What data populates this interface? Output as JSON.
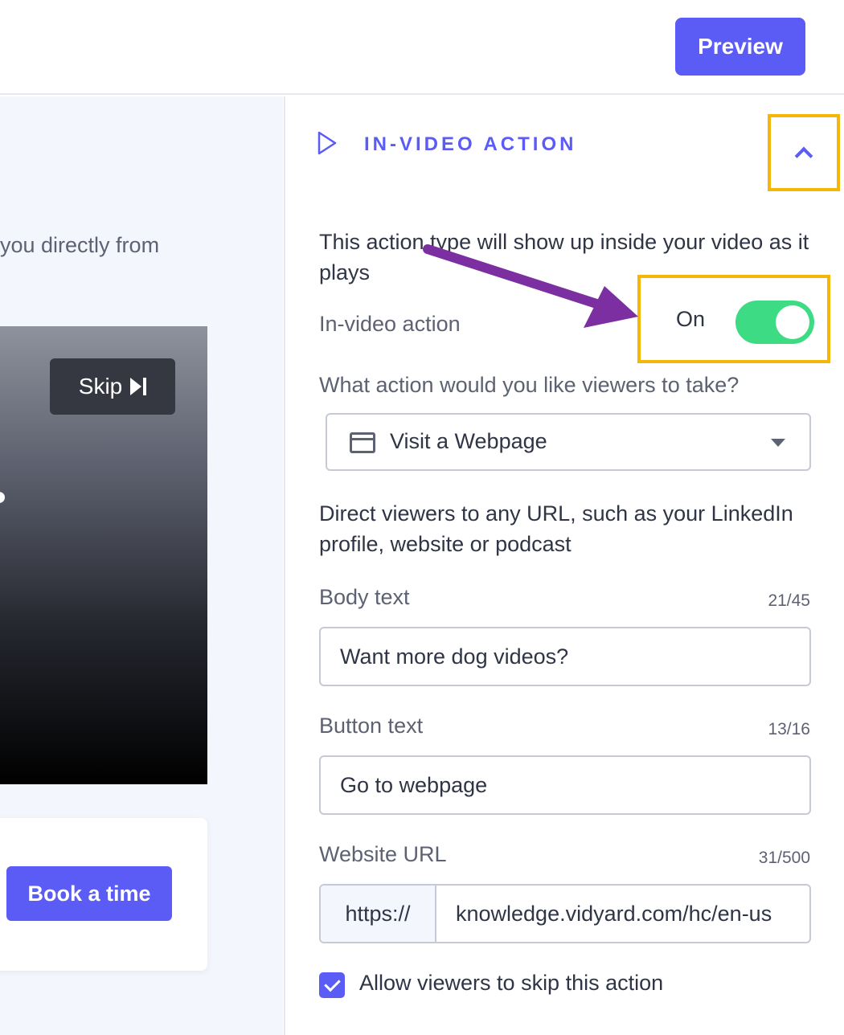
{
  "header": {
    "preview_label": "Preview"
  },
  "left_panel": {
    "description_fragment": "you directly from",
    "skip_label": "Skip",
    "book_label": "Book a time"
  },
  "section": {
    "title": "IN-VIDEO ACTION",
    "intro": "This action type will show up inside your video as it plays",
    "toggle_label": "In-video action",
    "toggle_state": "On",
    "question": "What action would you like viewers to take?",
    "action_value": "Visit a Webpage",
    "help_text": "Direct viewers to any URL, such as your LinkedIn profile, website or podcast"
  },
  "fields": {
    "body": {
      "label": "Body text",
      "count": "21/45",
      "value": "Want more dog videos?"
    },
    "button": {
      "label": "Button text",
      "count": "13/16",
      "value": "Go to webpage"
    },
    "url": {
      "label": "Website URL",
      "count": "31/500",
      "prefix": "https://",
      "value": "knowledge.vidyard.com/hc/en-us"
    }
  },
  "checkbox": {
    "label": "Allow viewers to skip this action",
    "checked": true
  },
  "colors": {
    "accent": "#5b5bf6",
    "toggle_on": "#3ddc84",
    "highlight": "#f5b60a",
    "annotation_arrow": "#7b2fa0"
  }
}
